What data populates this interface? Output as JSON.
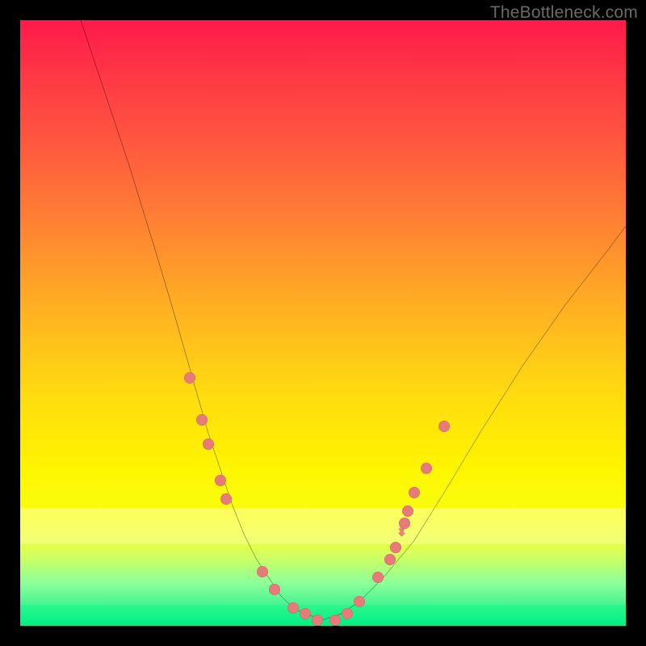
{
  "watermark": "TheBottleneck.com",
  "background": {
    "gradient_top": "#ff1a4a",
    "gradient_bottom": "#00e88a",
    "frame": "#000000"
  },
  "chart_data": {
    "type": "line",
    "title": "",
    "xlabel": "",
    "ylabel": "",
    "xlim": [
      0,
      100
    ],
    "ylim": [
      0,
      100
    ],
    "series": [
      {
        "name": "bottleneck-curve",
        "x": [
          10,
          14,
          18,
          22,
          25,
          27,
          29,
          31,
          33,
          35,
          37,
          39,
          41,
          43,
          45,
          47,
          50,
          53,
          56,
          60,
          65,
          70,
          76,
          83,
          90,
          97,
          100
        ],
        "y": [
          100,
          88,
          76,
          63,
          53,
          46,
          39,
          32,
          26,
          20,
          15,
          11,
          8,
          5,
          3,
          2,
          1,
          2,
          4,
          8,
          14,
          22,
          32,
          43,
          53,
          62,
          66
        ]
      }
    ],
    "markers": {
      "name": "highlight-points",
      "points": [
        {
          "x": 28,
          "y": 41,
          "kind": "dot"
        },
        {
          "x": 30,
          "y": 34,
          "kind": "dot"
        },
        {
          "x": 31,
          "y": 30,
          "kind": "dot"
        },
        {
          "x": 33,
          "y": 24,
          "kind": "dot"
        },
        {
          "x": 34,
          "y": 21,
          "kind": "dot"
        },
        {
          "x": 40,
          "y": 9,
          "kind": "dot"
        },
        {
          "x": 42,
          "y": 6,
          "kind": "dot"
        },
        {
          "x": 45,
          "y": 3,
          "kind": "dot"
        },
        {
          "x": 47,
          "y": 2,
          "kind": "dot"
        },
        {
          "x": 49,
          "y": 1,
          "kind": "dot"
        },
        {
          "x": 52,
          "y": 1,
          "kind": "dot"
        },
        {
          "x": 54,
          "y": 2,
          "kind": "dot"
        },
        {
          "x": 56,
          "y": 4,
          "kind": "dot"
        },
        {
          "x": 59,
          "y": 8,
          "kind": "dot"
        },
        {
          "x": 61,
          "y": 11,
          "kind": "dot"
        },
        {
          "x": 62,
          "y": 13,
          "kind": "dot"
        },
        {
          "x": 63,
          "y": 15,
          "kind": "flame"
        },
        {
          "x": 63.5,
          "y": 17,
          "kind": "dot"
        },
        {
          "x": 64,
          "y": 19,
          "kind": "dot"
        },
        {
          "x": 65,
          "y": 22,
          "kind": "dot"
        },
        {
          "x": 67,
          "y": 26,
          "kind": "dot"
        },
        {
          "x": 70,
          "y": 33,
          "kind": "dot"
        }
      ]
    },
    "bands": [
      {
        "name": "soft-yellow-band",
        "y_from": 14,
        "y_to": 20,
        "color": "#ffffa0"
      },
      {
        "name": "green-zone",
        "y_from": 0,
        "y_to": 3.5,
        "color": "#00ff82"
      }
    ]
  }
}
